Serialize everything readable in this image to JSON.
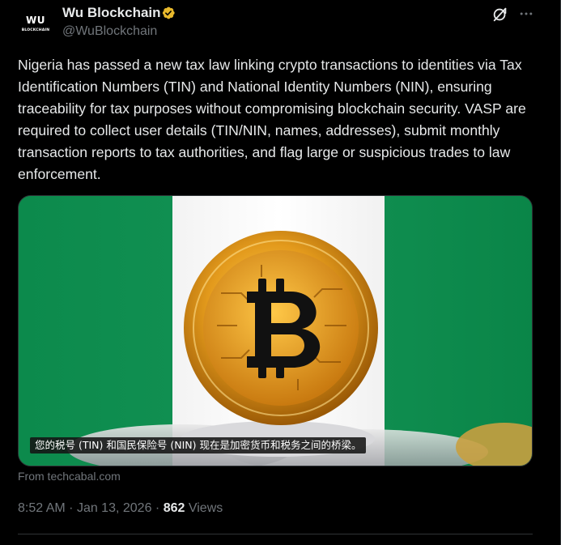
{
  "author": {
    "avatar_line1": "WU",
    "avatar_line2": "BLOCKCHAIN",
    "display_name": "Wu Blockchain",
    "handle": "@WuBlockchain",
    "verified_color": "#e8b92c"
  },
  "tweet": {
    "text": "Nigeria has passed a new tax law linking crypto transactions to identities via Tax Identification Numbers (TIN) and National Identity Numbers (NIN), ensuring traceability for tax purposes without compromising blockchain security. VASP are required to collect user details (TIN/NIN, names, addresses), submit monthly transaction reports to tax authorities, and flag large or suspicious trades to law enforcement.",
    "media_caption": "您的税号 (TIN) 和国民保险号 (NIN) 现在是加密货币和税务之间的桥梁。",
    "source": "From techcabal.com",
    "time": "8:52 AM",
    "separator": "·",
    "date": "Jan 13, 2026",
    "views_count": "862",
    "views_label": "Views"
  },
  "icons": {
    "verified": "verified-badge-icon",
    "grok": "grok-icon",
    "more": "more-options-icon"
  },
  "colors": {
    "background": "#000000",
    "text_primary": "#e7e9ea",
    "text_secondary": "#71767b",
    "flag_green": "#0c8a4c",
    "coin_gold": "#e0a020"
  }
}
